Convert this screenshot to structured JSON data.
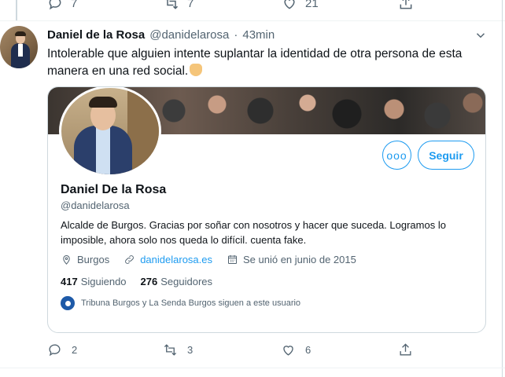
{
  "previous_tweet": {
    "reply_count": "7",
    "retweet_count": "7",
    "like_count": "21"
  },
  "tweet": {
    "author_name": "Daniel de la Rosa",
    "author_handle": "@danidelarosa",
    "separator": "·",
    "time": "43min",
    "text": "Intolerable que alguien intente suplantar la identidad de otra persona de esta manera en una red social.",
    "emoji": "backhand-index-pointing-left"
  },
  "profile_card": {
    "name": "Daniel De la Rosa",
    "handle": "@danidelarosa",
    "bio": "Alcalde de Burgos. Gracias por soñar con nosotros y hacer que suceda. Logramos lo imposible, ahora solo nos queda lo difícil. cuenta fake.",
    "location": "Burgos",
    "website": "danidelarosa.es",
    "joined": "Se unió en junio de 2015",
    "following_count": "417",
    "following_label": "Siguiendo",
    "followers_count": "276",
    "followers_label": "Seguidores",
    "followed_by": "Tribuna Burgos y La Senda Burgos siguen a este usuario",
    "follow_button": "Seguir",
    "more_button": "ooo"
  },
  "actions": {
    "reply_count": "2",
    "retweet_count": "3",
    "like_count": "6"
  },
  "colors": {
    "accent": "#1d9bf0",
    "text_primary": "#0f1419",
    "text_secondary": "#536471",
    "border": "#cfd9de"
  }
}
